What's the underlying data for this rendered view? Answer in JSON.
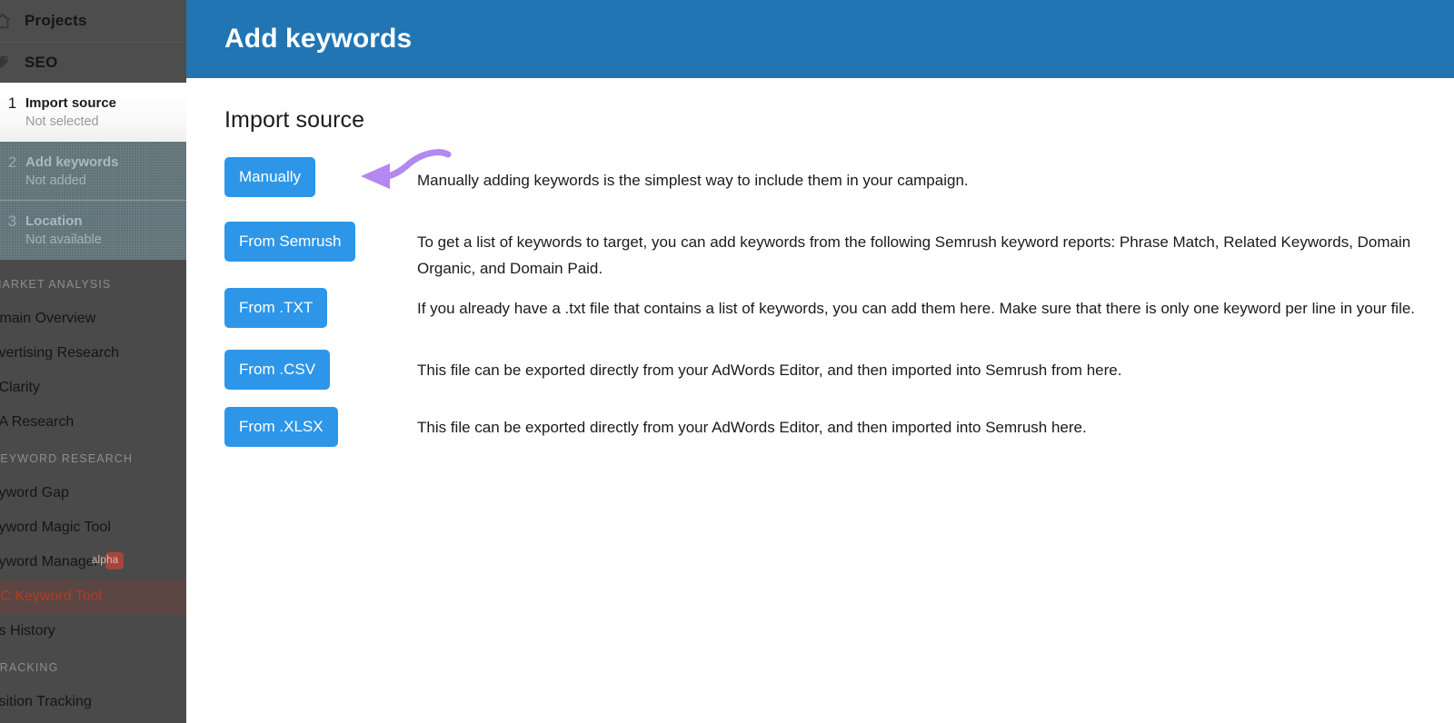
{
  "sidebar": {
    "headers": [
      {
        "label": "Projects",
        "icon": "home-icon"
      },
      {
        "label": "SEO",
        "icon": "tag-icon"
      }
    ],
    "steps": [
      {
        "num": "1",
        "title": "Import source",
        "status": "Not selected",
        "state": "active"
      },
      {
        "num": "2",
        "title": "Add keywords",
        "status": "Not added",
        "state": "disabled"
      },
      {
        "num": "3",
        "title": "Location",
        "status": "Not available",
        "state": "disabled"
      }
    ],
    "groups": [
      {
        "label": "MARKET ANALYSIS",
        "items": [
          {
            "label": "Domain Overview"
          },
          {
            "label": "Advertising Research"
          },
          {
            "label": "AdClarity"
          },
          {
            "label": "PLA Research"
          }
        ]
      },
      {
        "label": "KEYWORD RESEARCH",
        "items": [
          {
            "label": "Keyword Gap"
          },
          {
            "label": "Keyword Magic Tool"
          },
          {
            "label": "Keyword Manager",
            "badge": "alpha"
          },
          {
            "label": "PPC Keyword Tool",
            "highlight": true
          },
          {
            "label": "Ads History"
          }
        ]
      },
      {
        "label": "TRACKING",
        "items": [
          {
            "label": "Position Tracking"
          }
        ]
      }
    ]
  },
  "header": {
    "title": "Add keywords",
    "bg_color": "#2275b3"
  },
  "main": {
    "section_title": "Import source",
    "button_color": "#2d96e8",
    "options": [
      {
        "button": "Manually",
        "description": "Manually adding keywords is the simplest way to include them in your campaign."
      },
      {
        "button": "From Semrush",
        "description": "To get a list of keywords to target, you can add keywords from the following Semrush keyword reports: Phrase Match, Related Keywords, Domain Organic, and Domain Paid."
      },
      {
        "button": "From .TXT",
        "description": "If you already have a .txt file that contains a list of keywords, you can add them here. Make sure that there is only one keyword per line in your file."
      },
      {
        "button": "From .CSV",
        "description": "This file can be exported directly from your AdWords Editor, and then imported into Semrush from here."
      },
      {
        "button": "From .XLSX",
        "description": "This file can be exported directly from your AdWords Editor, and then imported into Semrush here."
      }
    ]
  },
  "annotation": {
    "type": "curved-arrow",
    "color": "#b388f0",
    "points_to": "Manually"
  }
}
